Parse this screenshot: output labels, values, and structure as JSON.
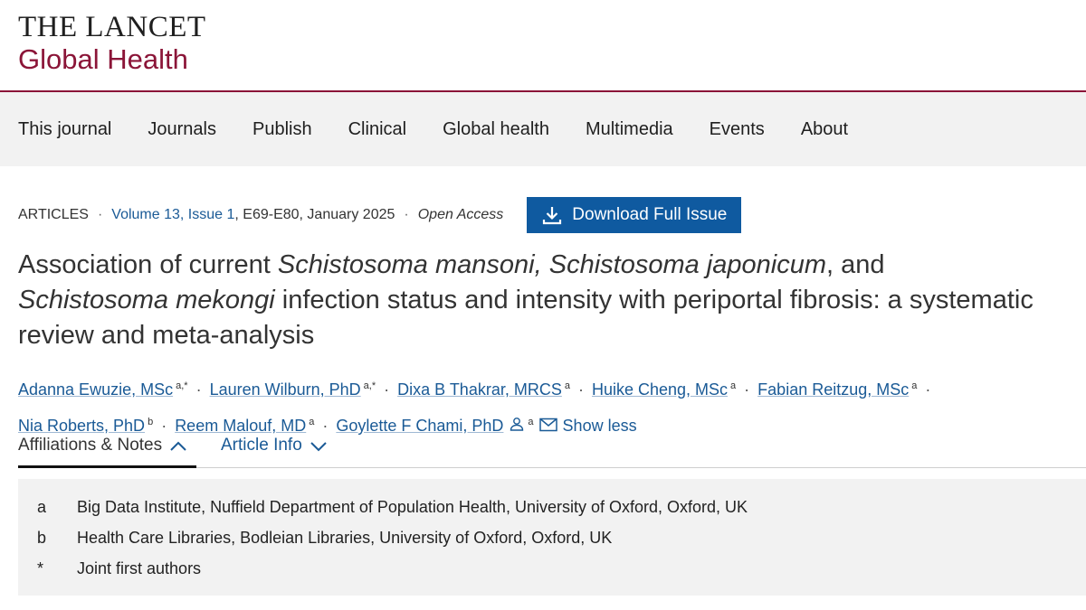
{
  "brand": {
    "line1": "THE LANCET",
    "line2": "Global Health"
  },
  "nav": [
    "This journal",
    "Journals",
    "Publish",
    "Clinical",
    "Global health",
    "Multimedia",
    "Events",
    "About"
  ],
  "meta": {
    "section": "ARTICLES",
    "issue": "Volume 13, Issue 1",
    "pages": ", E69-E80, January 2025",
    "access": "Open Access",
    "download": "Download Full Issue"
  },
  "article": {
    "t1": "Association of current ",
    "t2": "Schistosoma mansoni, Schistosoma japonicum",
    "t3": ", and",
    "t4": "Schistosoma mekongi",
    "t5": " infection status and intensity with periportal fibrosis: a systematic review and meta-analysis"
  },
  "authors": [
    {
      "name": "Adanna Ewuzie, MSc",
      "sup": "a,*"
    },
    {
      "name": "Lauren Wilburn, PhD",
      "sup": "a,*"
    },
    {
      "name": "Dixa B Thakrar, MRCS",
      "sup": "a"
    },
    {
      "name": "Huike Cheng, MSc",
      "sup": "a"
    },
    {
      "name": "Fabian Reitzug, MSc",
      "sup": "a"
    },
    {
      "name": "Nia Roberts, PhD",
      "sup": "b"
    },
    {
      "name": "Reem Malouf, MD",
      "sup": "a"
    },
    {
      "name": "Goylette F Chami, PhD",
      "sup": "a"
    }
  ],
  "show_less": "Show less",
  "tabs": {
    "affiliations": "Affiliations & Notes",
    "info": "Article Info"
  },
  "affiliations": [
    {
      "key": "a",
      "text": "Big Data Institute, Nuffield Department of Population Health, University of Oxford, Oxford, UK"
    },
    {
      "key": "b",
      "text": "Health Care Libraries, Bodleian Libraries, University of Oxford, Oxford, UK"
    },
    {
      "key": "*",
      "text": "Joint first authors"
    }
  ],
  "colors": {
    "brand": "#8b1538",
    "link": "#1a5a96",
    "button": "#0f5aa0",
    "panel": "#f2f2f2"
  }
}
